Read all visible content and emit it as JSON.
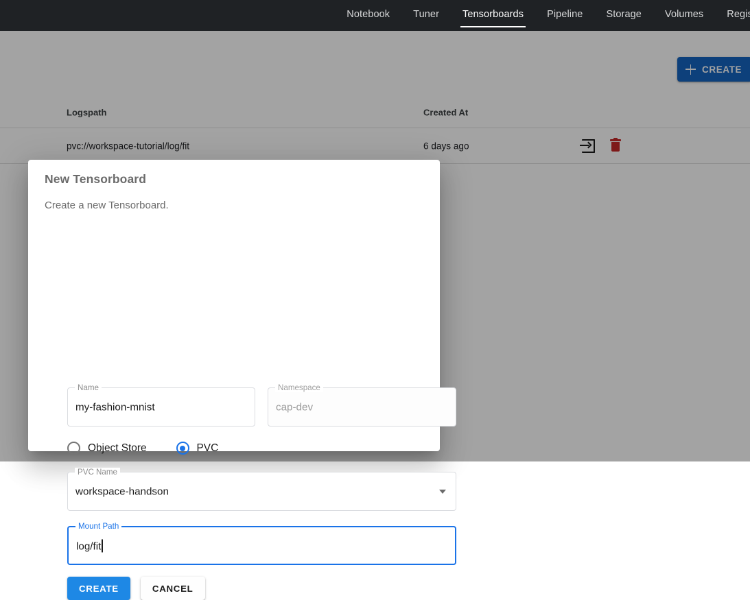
{
  "topnav": {
    "tabs": [
      {
        "label": "Notebook",
        "active": false
      },
      {
        "label": "Tuner",
        "active": false
      },
      {
        "label": "Tensorboards",
        "active": true
      },
      {
        "label": "Pipeline",
        "active": false
      },
      {
        "label": "Storage",
        "active": false
      },
      {
        "label": "Volumes",
        "active": false
      },
      {
        "label": "Regist",
        "active": false
      }
    ],
    "background_color": "#1f2225"
  },
  "toolbar": {
    "create_label": "CREATE",
    "create_color": "#1565c0"
  },
  "table": {
    "columns": [
      "Logspath",
      "Created At"
    ],
    "rows": [
      {
        "logspath": "pvc://workspace-tutorial/log/fit",
        "created_at": "6 days ago",
        "actions": [
          "connect-icon",
          "delete-icon"
        ]
      }
    ]
  },
  "dialog": {
    "title": "New Tensorboard",
    "subtitle": "Create a new Tensorboard.",
    "fields": {
      "name": {
        "label": "Name",
        "value": "my-fashion-mnist",
        "disabled": false
      },
      "namespace": {
        "label": "Namespace",
        "value": "cap-dev",
        "disabled": true
      },
      "pvc_name": {
        "label": "PVC Name",
        "value": "workspace-handson",
        "disabled": false
      },
      "mount_path": {
        "label": "Mount Path",
        "value": "log/fit",
        "focused": true
      }
    },
    "source_type": {
      "options": [
        {
          "label": "Object Store",
          "selected": false
        },
        {
          "label": "PVC",
          "selected": true
        }
      ],
      "accent_color": "#1a73e8"
    },
    "actions": {
      "create_label": "CREATE",
      "cancel_label": "CANCEL",
      "create_color": "#1e88e5"
    }
  }
}
